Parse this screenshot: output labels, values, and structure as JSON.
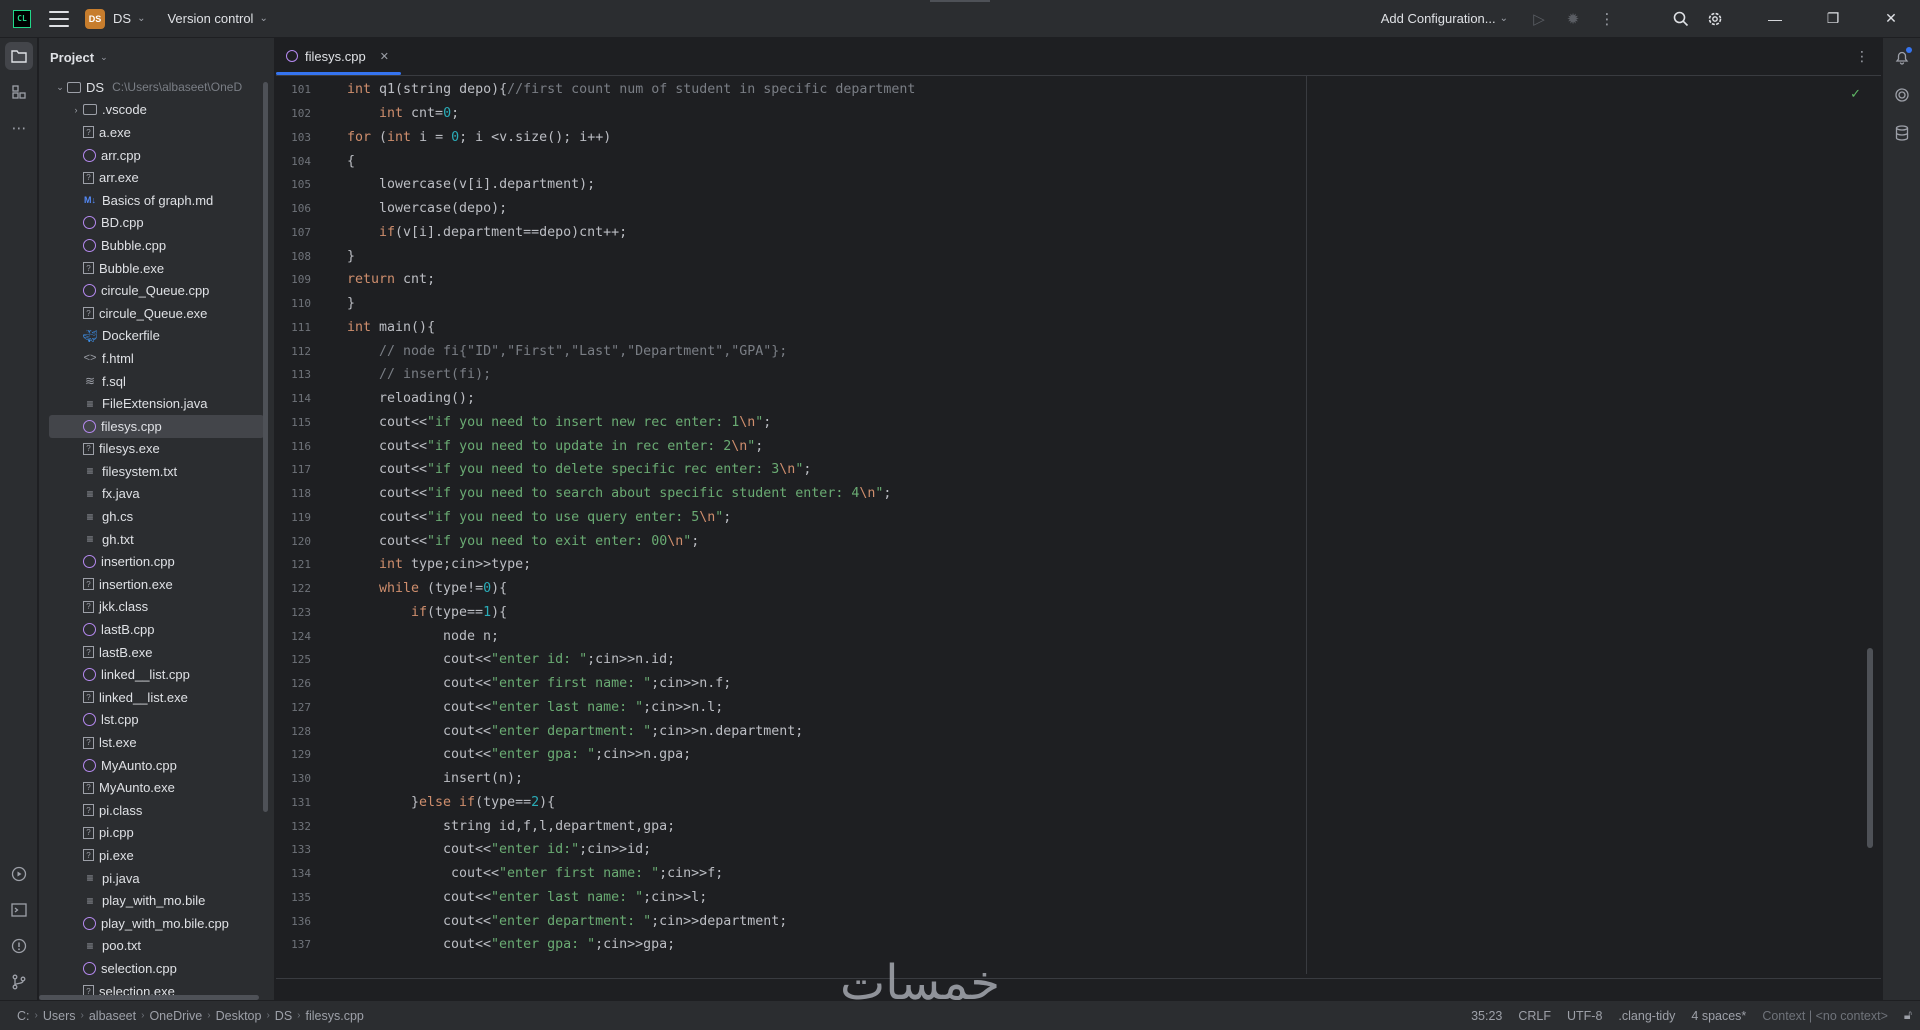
{
  "titlebar": {
    "logo": "CL",
    "project_badge": "DS",
    "project_name": "DS",
    "vcs_label": "Version control",
    "add_config": "Add Configuration..."
  },
  "project_panel": {
    "title": "Project",
    "root": {
      "name": "DS",
      "path": "C:\\Users\\albaseet\\OneD"
    },
    "items": [
      {
        "name": ".vscode",
        "type": "folder"
      },
      {
        "name": "a.exe",
        "type": "exe"
      },
      {
        "name": "arr.cpp",
        "type": "cpp"
      },
      {
        "name": "arr.exe",
        "type": "exe"
      },
      {
        "name": "Basics of graph.md",
        "type": "md"
      },
      {
        "name": "BD.cpp",
        "type": "cpp"
      },
      {
        "name": "Bubble.cpp",
        "type": "cpp"
      },
      {
        "name": "Bubble.exe",
        "type": "exe"
      },
      {
        "name": "circule_Queue.cpp",
        "type": "cpp"
      },
      {
        "name": "circule_Queue.exe",
        "type": "exe"
      },
      {
        "name": "Dockerfile",
        "type": "docker"
      },
      {
        "name": "f.html",
        "type": "html"
      },
      {
        "name": "f.sql",
        "type": "sql"
      },
      {
        "name": "FileExtension.java",
        "type": "txt"
      },
      {
        "name": "filesys.cpp",
        "type": "cpp",
        "selected": true
      },
      {
        "name": "filesys.exe",
        "type": "exe"
      },
      {
        "name": "filesystem.txt",
        "type": "txt"
      },
      {
        "name": "fx.java",
        "type": "txt"
      },
      {
        "name": "gh.cs",
        "type": "txt"
      },
      {
        "name": "gh.txt",
        "type": "txt"
      },
      {
        "name": "insertion.cpp",
        "type": "cpp"
      },
      {
        "name": "insertion.exe",
        "type": "exe"
      },
      {
        "name": "jkk.class",
        "type": "exe"
      },
      {
        "name": "lastB.cpp",
        "type": "cpp"
      },
      {
        "name": "lastB.exe",
        "type": "exe"
      },
      {
        "name": "linked__list.cpp",
        "type": "cpp"
      },
      {
        "name": "linked__list.exe",
        "type": "exe"
      },
      {
        "name": "lst.cpp",
        "type": "cpp"
      },
      {
        "name": "lst.exe",
        "type": "exe"
      },
      {
        "name": "MyAunto.cpp",
        "type": "cpp"
      },
      {
        "name": "MyAunto.exe",
        "type": "exe"
      },
      {
        "name": "pi.class",
        "type": "exe"
      },
      {
        "name": "pi.cpp",
        "type": "exe"
      },
      {
        "name": "pi.exe",
        "type": "exe"
      },
      {
        "name": "pi.java",
        "type": "txt"
      },
      {
        "name": "play_with_mo.bile",
        "type": "txt"
      },
      {
        "name": "play_with_mo.bile.cpp",
        "type": "cpp"
      },
      {
        "name": "poo.txt",
        "type": "txt"
      },
      {
        "name": "selection.cpp",
        "type": "cpp"
      },
      {
        "name": "selection.exe",
        "type": "exe"
      }
    ]
  },
  "editor": {
    "tab_label": "filesys.cpp",
    "lines": [
      {
        "n": "101",
        "indent": 0,
        "tokens": [
          [
            "kw",
            "int "
          ],
          [
            "txt",
            "q1(string depo){"
          ],
          [
            "cmt",
            "//first count num of student in specific department"
          ]
        ]
      },
      {
        "n": "102",
        "indent": 1,
        "tokens": [
          [
            "kw",
            "int "
          ],
          [
            "txt",
            "cnt="
          ],
          [
            "num",
            "0"
          ],
          [
            "txt",
            ";"
          ]
        ]
      },
      {
        "n": "103",
        "indent": 0,
        "tokens": [
          [
            "kw",
            "for "
          ],
          [
            "txt",
            "("
          ],
          [
            "kw",
            "int "
          ],
          [
            "txt",
            "i = "
          ],
          [
            "num",
            "0"
          ],
          [
            "txt",
            "; i <v.size(); i++)"
          ]
        ]
      },
      {
        "n": "104",
        "indent": 0,
        "tokens": [
          [
            "txt",
            "{"
          ]
        ]
      },
      {
        "n": "105",
        "indent": 1,
        "tokens": [
          [
            "txt",
            "lowercase(v[i].department);"
          ]
        ]
      },
      {
        "n": "106",
        "indent": 1,
        "tokens": [
          [
            "txt",
            "lowercase(depo);"
          ]
        ]
      },
      {
        "n": "107",
        "indent": 1,
        "tokens": [
          [
            "kw",
            "if"
          ],
          [
            "txt",
            "(v[i].department==depo)cnt++;"
          ]
        ]
      },
      {
        "n": "108",
        "indent": 0,
        "tokens": [
          [
            "txt",
            "}"
          ]
        ]
      },
      {
        "n": "109",
        "indent": 0,
        "tokens": [
          [
            "kw",
            "return "
          ],
          [
            "txt",
            "cnt;"
          ]
        ]
      },
      {
        "n": "110",
        "indent": 0,
        "tokens": [
          [
            "txt",
            "}"
          ]
        ]
      },
      {
        "n": "111",
        "indent": 0,
        "tokens": [
          [
            "kw",
            "int "
          ],
          [
            "txt",
            "main(){"
          ]
        ]
      },
      {
        "n": "112",
        "indent": 1,
        "tokens": [
          [
            "cmt",
            "// node fi{\"ID\",\"First\",\"Last\",\"Department\",\"GPA\"};"
          ]
        ]
      },
      {
        "n": "113",
        "indent": 1,
        "tokens": [
          [
            "cmt",
            "// insert(fi);"
          ]
        ]
      },
      {
        "n": "114",
        "indent": 1,
        "tokens": [
          [
            "txt",
            "reloading();"
          ]
        ]
      },
      {
        "n": "115",
        "indent": 1,
        "tokens": [
          [
            "txt",
            "cout<<"
          ],
          [
            "str",
            "\"if you need to insert new rec enter: 1"
          ],
          [
            "esc",
            "\\n"
          ],
          [
            "str",
            "\""
          ],
          [
            "txt",
            ";"
          ]
        ]
      },
      {
        "n": "116",
        "indent": 1,
        "tokens": [
          [
            "txt",
            "cout<<"
          ],
          [
            "str",
            "\"if you need to update in rec enter: 2"
          ],
          [
            "esc",
            "\\n"
          ],
          [
            "str",
            "\""
          ],
          [
            "txt",
            ";"
          ]
        ]
      },
      {
        "n": "117",
        "indent": 1,
        "tokens": [
          [
            "txt",
            "cout<<"
          ],
          [
            "str",
            "\"if you need to delete specific rec enter: 3"
          ],
          [
            "esc",
            "\\n"
          ],
          [
            "str",
            "\""
          ],
          [
            "txt",
            ";"
          ]
        ]
      },
      {
        "n": "118",
        "indent": 1,
        "tokens": [
          [
            "txt",
            "cout<<"
          ],
          [
            "str",
            "\"if you need to search about specific student enter: 4"
          ],
          [
            "esc",
            "\\n"
          ],
          [
            "str",
            "\""
          ],
          [
            "txt",
            ";"
          ]
        ]
      },
      {
        "n": "119",
        "indent": 1,
        "tokens": [
          [
            "txt",
            "cout<<"
          ],
          [
            "str",
            "\"if you need to use query enter: 5"
          ],
          [
            "esc",
            "\\n"
          ],
          [
            "str",
            "\""
          ],
          [
            "txt",
            ";"
          ]
        ]
      },
      {
        "n": "120",
        "indent": 1,
        "tokens": [
          [
            "txt",
            "cout<<"
          ],
          [
            "str",
            "\"if you need to exit enter: 00"
          ],
          [
            "esc",
            "\\n"
          ],
          [
            "str",
            "\""
          ],
          [
            "txt",
            ";"
          ]
        ]
      },
      {
        "n": "121",
        "indent": 1,
        "tokens": [
          [
            "kw",
            "int "
          ],
          [
            "txt",
            "type;cin>>type;"
          ]
        ]
      },
      {
        "n": "122",
        "indent": 1,
        "tokens": [
          [
            "kw",
            "while "
          ],
          [
            "txt",
            "(type!="
          ],
          [
            "num",
            "0"
          ],
          [
            "txt",
            "){"
          ]
        ]
      },
      {
        "n": "123",
        "indent": 2,
        "tokens": [
          [
            "kw",
            "if"
          ],
          [
            "txt",
            "(type=="
          ],
          [
            "num",
            "1"
          ],
          [
            "txt",
            "){"
          ]
        ]
      },
      {
        "n": "124",
        "indent": 3,
        "tokens": [
          [
            "txt",
            "node n;"
          ]
        ]
      },
      {
        "n": "125",
        "indent": 3,
        "tokens": [
          [
            "txt",
            "cout<<"
          ],
          [
            "str",
            "\"enter id: \""
          ],
          [
            "txt",
            ";cin>>n.id;"
          ]
        ]
      },
      {
        "n": "126",
        "indent": 3,
        "tokens": [
          [
            "txt",
            "cout<<"
          ],
          [
            "str",
            "\"enter first name: \""
          ],
          [
            "txt",
            ";cin>>n.f;"
          ]
        ]
      },
      {
        "n": "127",
        "indent": 3,
        "tokens": [
          [
            "txt",
            "cout<<"
          ],
          [
            "str",
            "\"enter last name: \""
          ],
          [
            "txt",
            ";cin>>n.l;"
          ]
        ]
      },
      {
        "n": "128",
        "indent": 3,
        "tokens": [
          [
            "txt",
            "cout<<"
          ],
          [
            "str",
            "\"enter department: \""
          ],
          [
            "txt",
            ";cin>>n.department;"
          ]
        ]
      },
      {
        "n": "129",
        "indent": 3,
        "tokens": [
          [
            "txt",
            "cout<<"
          ],
          [
            "str",
            "\"enter gpa: \""
          ],
          [
            "txt",
            ";cin>>n.gpa;"
          ]
        ]
      },
      {
        "n": "130",
        "indent": 3,
        "tokens": [
          [
            "txt",
            "insert(n);"
          ]
        ]
      },
      {
        "n": "131",
        "indent": 2,
        "tokens": [
          [
            "txt",
            "}"
          ],
          [
            "kw",
            "else if"
          ],
          [
            "txt",
            "(type=="
          ],
          [
            "num",
            "2"
          ],
          [
            "txt",
            "){"
          ]
        ]
      },
      {
        "n": "132",
        "indent": 3,
        "tokens": [
          [
            "txt",
            "string id,f,l,department,gpa;"
          ]
        ]
      },
      {
        "n": "133",
        "indent": 3,
        "tokens": [
          [
            "txt",
            "cout<<"
          ],
          [
            "str",
            "\"enter id:\""
          ],
          [
            "txt",
            ";cin>>id;"
          ]
        ]
      },
      {
        "n": "134",
        "indent": 3,
        "tokens": [
          [
            "txt",
            " cout<<"
          ],
          [
            "str",
            "\"enter first name: \""
          ],
          [
            "txt",
            ";cin>>f;"
          ]
        ]
      },
      {
        "n": "135",
        "indent": 3,
        "tokens": [
          [
            "txt",
            "cout<<"
          ],
          [
            "str",
            "\"enter last name: \""
          ],
          [
            "txt",
            ";cin>>l;"
          ]
        ]
      },
      {
        "n": "136",
        "indent": 3,
        "tokens": [
          [
            "txt",
            "cout<<"
          ],
          [
            "str",
            "\"enter department: \""
          ],
          [
            "txt",
            ";cin>>department;"
          ]
        ]
      },
      {
        "n": "137",
        "indent": 3,
        "tokens": [
          [
            "txt",
            "cout<<"
          ],
          [
            "str",
            "\"enter gpa: \""
          ],
          [
            "txt",
            ";cin>>gpa;"
          ]
        ]
      }
    ]
  },
  "statusbar": {
    "crumbs": [
      "C:",
      "Users",
      "albaseet",
      "OneDrive",
      "Desktop",
      "DS",
      "filesys.cpp"
    ],
    "position": "35:23",
    "line_sep": "CRLF",
    "encoding": "UTF-8",
    "linter": ".clang-tidy",
    "indent": "4 spaces*",
    "context": "Context",
    "no_context": "<no context>"
  },
  "watermark": "خمسات"
}
